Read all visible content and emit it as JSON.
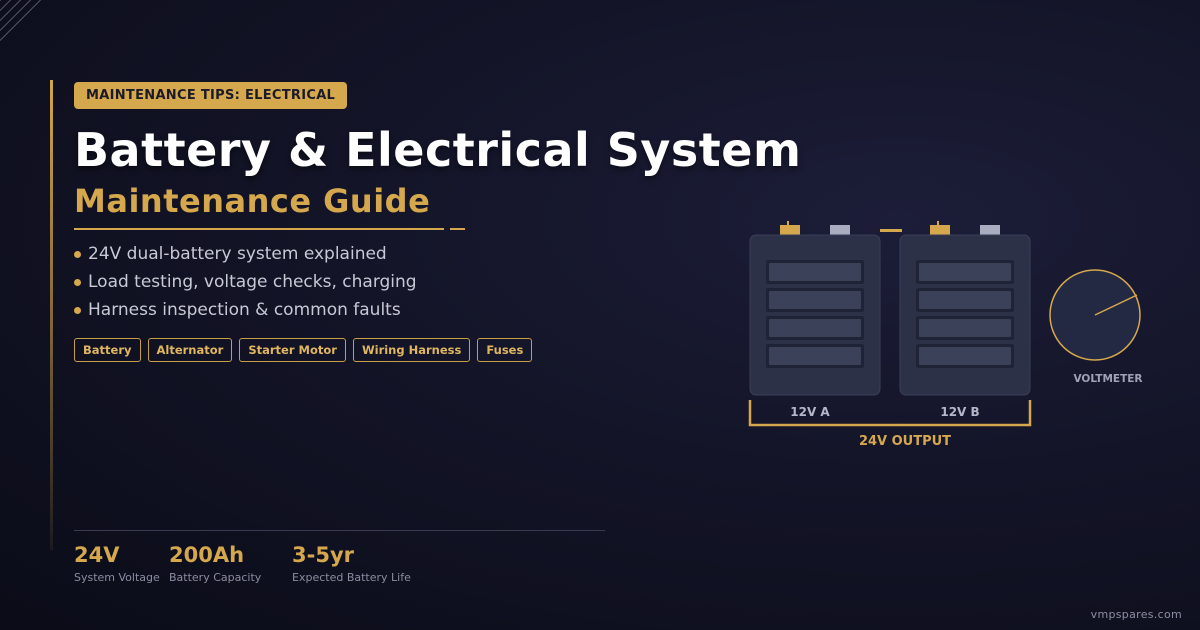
{
  "badge": "MAINTENANCE TIPS: ELECTRICAL",
  "title": "Battery & Electrical System",
  "subtitle": "Maintenance Guide",
  "bullets": [
    "24V dual-battery system explained",
    "Load testing, voltage checks, charging",
    "Harness inspection & common faults"
  ],
  "tags": [
    "Battery",
    "Alternator",
    "Starter Motor",
    "Wiring Harness",
    "Fuses"
  ],
  "stats": [
    {
      "value": "24V",
      "label": "System Voltage"
    },
    {
      "value": "200Ah",
      "label": "Battery Capacity"
    },
    {
      "value": "3-5yr",
      "label": "Expected Battery Life"
    }
  ],
  "illustration": {
    "battery_a_label": "12V A",
    "battery_b_label": "12V B",
    "output_label": "24V OUTPUT",
    "voltmeter_label": "VOLTMETER"
  },
  "brand": "vmpspares.com",
  "colors": {
    "accent": "#d6a84e",
    "background": "#131427",
    "battery_body": "#2c3148",
    "terminal_negative": "#a9adbf"
  }
}
